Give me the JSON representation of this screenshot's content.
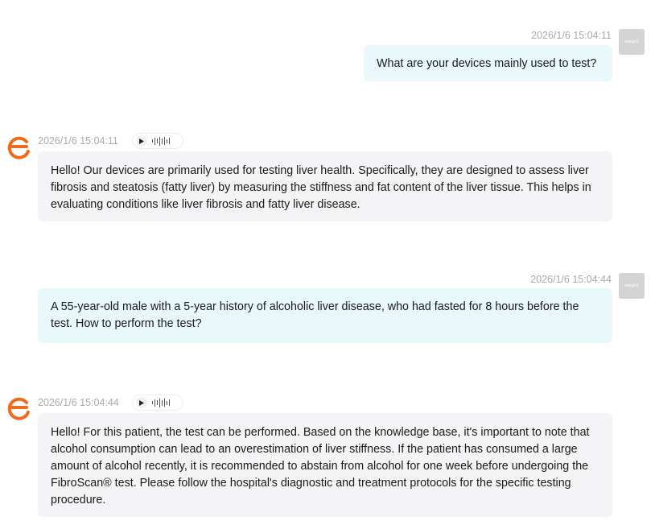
{
  "conversation": {
    "messages": [
      {
        "role": "user",
        "timestamp": "2026/1/6 15:04:11",
        "avatar_label": "wangk3",
        "text": "What are your devices mainly used to test?"
      },
      {
        "role": "assistant",
        "timestamp": "2026/1/6 15:04:11",
        "avatar_icon": "brand-logo-icon",
        "audio_icons": [
          "play-icon",
          "waveform-icon"
        ],
        "text": "Hello! Our devices are primarily used for testing liver health. Specifically, they are designed to assess liver fibrosis and steatosis (fatty liver) by measuring the stiffness and fat content of the liver tissue. This helps in evaluating conditions like liver fibrosis and fatty liver disease."
      },
      {
        "role": "user",
        "timestamp": "2026/1/6 15:04:44",
        "avatar_label": "wangk3",
        "text": "A 55-year-old male with a 5-year history of alcoholic liver disease, who had fasted for 8 hours before the test. How to perform the test?"
      },
      {
        "role": "assistant",
        "timestamp": "2026/1/6 15:04:44",
        "avatar_icon": "brand-logo-icon",
        "audio_icons": [
          "play-icon",
          "waveform-icon"
        ],
        "text": "Hello! For this patient, the test can be performed. Based on the knowledge base, it's important to note that alcohol consumption can lead to an overestimation of liver stiffness. If the patient has consumed a large amount of alcohol recently, it is recommended to abstain from alcohol for one week before undergoing the FibroScan® test. Please follow the hospital's diagnostic and treatment protocols for the specific testing procedure."
      }
    ]
  },
  "colors": {
    "user_bubble": "#e9f8fa",
    "bot_bubble": "#f4f4f6",
    "brand_orange": "#ee6a1c",
    "timestamp": "#a9a9ad",
    "user_avatar": "#d4d4d6"
  }
}
